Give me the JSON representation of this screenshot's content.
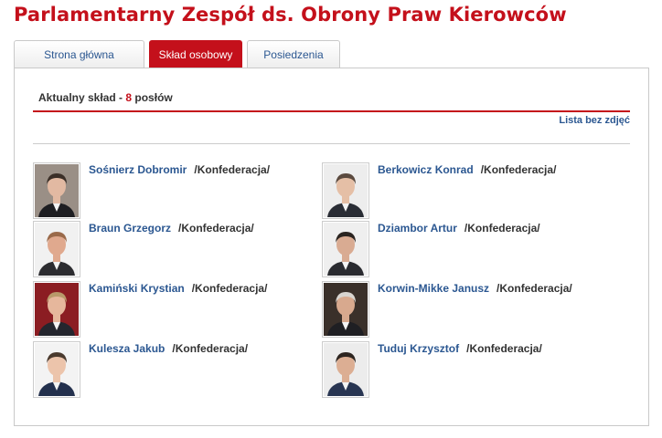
{
  "page": {
    "title": "Parlamentarny Zespół ds. Obrony Praw Kierowców"
  },
  "tabs": [
    {
      "label": "Strona główna",
      "active": false
    },
    {
      "label": "Skład osobowy",
      "active": true
    },
    {
      "label": "Posiedzenia",
      "active": false
    }
  ],
  "composition": {
    "summary_prefix": "Aktualny skład - ",
    "count": "8",
    "summary_suffix": " posłów",
    "list_link": "Lista bez zdjęć"
  },
  "members": [
    {
      "name": "Sośnierz Dobromir",
      "club": "/Konfederacja/",
      "photo_bg": "#9a8f86",
      "suit": "#1e1e22",
      "hair": "#3b2f28",
      "skin": "#e2b9a2"
    },
    {
      "name": "Berkowicz Konrad",
      "club": "/Konfederacja/",
      "photo_bg": "#ededed",
      "suit": "#2a2d35",
      "hair": "#5b4a3f",
      "skin": "#e5bfa6"
    },
    {
      "name": "Braun Grzegorz",
      "club": "/Konfederacja/",
      "photo_bg": "#f1f1f1",
      "suit": "#2c2c30",
      "hair": "#9a6a4a",
      "skin": "#e0a98e"
    },
    {
      "name": "Dziambor Artur",
      "club": "/Konfederacja/",
      "photo_bg": "#efefef",
      "suit": "#2a2b30",
      "hair": "#2a2420",
      "skin": "#d9ab92"
    },
    {
      "name": "Kamiński Krystian",
      "club": "/Konfederacja/",
      "photo_bg": "#8b1d22",
      "suit": "#24262e",
      "hair": "#b89a6a",
      "skin": "#e6b79c"
    },
    {
      "name": "Korwin-Mikke Janusz",
      "club": "/Konfederacja/",
      "photo_bg": "#3a302a",
      "suit": "#1f1f23",
      "hair": "#d9d5d0",
      "skin": "#d8a98e"
    },
    {
      "name": "Kulesza Jakub",
      "club": "/Konfederacja/",
      "photo_bg": "#f3f3f3",
      "suit": "#23304d",
      "hair": "#4a3a2e",
      "skin": "#ecc4ab"
    },
    {
      "name": "Tuduj Krzysztof",
      "club": "/Konfederacja/",
      "photo_bg": "#ececec",
      "suit": "#283552",
      "hair": "#2d2520",
      "skin": "#dcae93"
    }
  ]
}
